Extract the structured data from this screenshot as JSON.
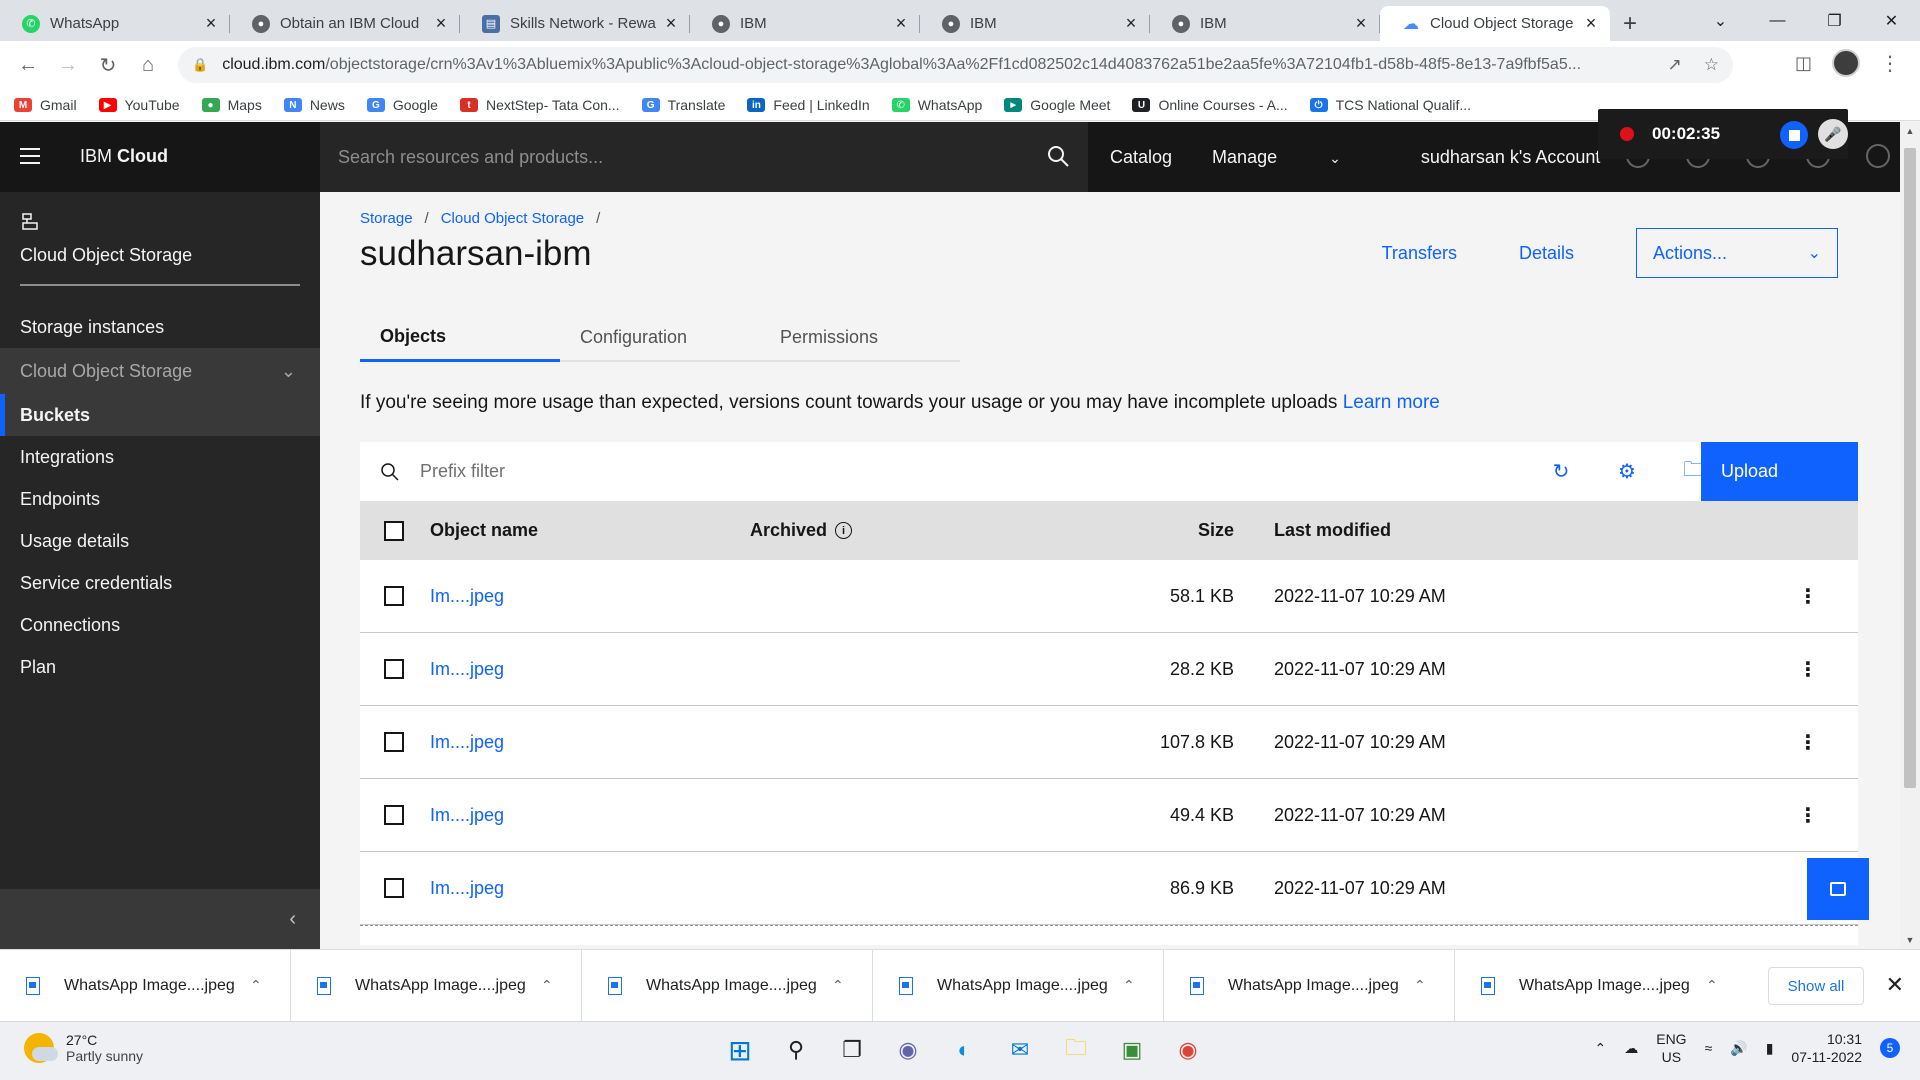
{
  "browser": {
    "tabs": [
      {
        "title": "WhatsApp",
        "fav_color": "#25d366",
        "icon": "whatsapp-icon"
      },
      {
        "title": "Obtain an IBM Cloud",
        "fav_color": "#5f6368",
        "icon": "globe-icon"
      },
      {
        "title": "Skills Network - Rewa",
        "fav_color": "#4a6fa5",
        "icon": "skills-network-icon"
      },
      {
        "title": "IBM",
        "fav_color": "#5f6368",
        "icon": "globe-icon"
      },
      {
        "title": "IBM",
        "fav_color": "#5f6368",
        "icon": "globe-icon"
      },
      {
        "title": "IBM",
        "fav_color": "#5f6368",
        "icon": "globe-icon"
      },
      {
        "title": "Cloud Object Storage",
        "fav_color": "#4589ff",
        "icon": "cloud-icon",
        "active": true
      }
    ],
    "url_host": "cloud.ibm.com",
    "url_path": "/objectstorage/crn%3Av1%3Abluemix%3Apublic%3Acloud-object-storage%3Aglobal%3Aa%2Ff1cd082502c14d4083762a51be2aa5fe%3A72104fb1-d58b-48f5-8e13-7a9fbf5a5...",
    "bookmarks": [
      {
        "label": "Gmail",
        "color": "#ea4335",
        "icon": "gmail-icon"
      },
      {
        "label": "YouTube",
        "color": "#ff0000",
        "icon": "youtube-icon"
      },
      {
        "label": "Maps",
        "color": "#34a853",
        "icon": "maps-icon"
      },
      {
        "label": "News",
        "color": "#4285f4",
        "icon": "news-icon"
      },
      {
        "label": "Google",
        "color": "#4285f4",
        "icon": "google-icon"
      },
      {
        "label": "NextStep- Tata Con...",
        "color": "#d93025",
        "icon": "tcs-icon"
      },
      {
        "label": "Translate",
        "color": "#4285f4",
        "icon": "translate-icon"
      },
      {
        "label": "Feed | LinkedIn",
        "color": "#0a66c2",
        "icon": "linkedin-icon"
      },
      {
        "label": "WhatsApp",
        "color": "#25d366",
        "icon": "whatsapp-icon"
      },
      {
        "label": "Google Meet",
        "color": "#00897b",
        "icon": "meet-icon"
      },
      {
        "label": "Online Courses - A...",
        "color": "#202124",
        "icon": "courses-icon"
      },
      {
        "label": "TCS National Qualif...",
        "color": "#1a73e8",
        "icon": "power-icon"
      }
    ]
  },
  "recorder": {
    "time": "00:02:35"
  },
  "header": {
    "brand_prefix": "IBM",
    "brand_suffix": "Cloud",
    "search_placeholder": "Search resources and products...",
    "catalog": "Catalog",
    "manage": "Manage",
    "account": "sudharsan k's Account"
  },
  "sidebar": {
    "service_title": "Cloud Object Storage",
    "items": [
      {
        "label": "Storage instances"
      }
    ],
    "section": "Cloud Object Storage",
    "selected": "Buckets",
    "sub_items": [
      "Integrations",
      "Endpoints",
      "Usage details",
      "Service credentials",
      "Connections",
      "Plan"
    ]
  },
  "main": {
    "breadcrumb": [
      "Storage",
      "Cloud Object Storage"
    ],
    "title": "sudharsan-ibm",
    "transfers": "Transfers",
    "details": "Details",
    "actions": "Actions...",
    "tabs": [
      "Objects",
      "Configuration",
      "Permissions"
    ],
    "notice_text": "If you're seeing more usage than expected, versions count towards your usage or you may have incomplete uploads",
    "notice_link": "Learn more",
    "filter_placeholder": "Prefix filter",
    "upload": "Upload",
    "columns": {
      "name": "Object name",
      "archived": "Archived",
      "size": "Size",
      "modified": "Last modified"
    },
    "rows": [
      {
        "name": "Im....jpeg",
        "size": "58.1 KB",
        "modified": "2022-11-07 10:29 AM"
      },
      {
        "name": "Im....jpeg",
        "size": "28.2 KB",
        "modified": "2022-11-07 10:29 AM"
      },
      {
        "name": "Im....jpeg",
        "size": "107.8 KB",
        "modified": "2022-11-07 10:29 AM"
      },
      {
        "name": "Im....jpeg",
        "size": "49.4 KB",
        "modified": "2022-11-07 10:29 AM"
      },
      {
        "name": "Im....jpeg",
        "size": "86.9 KB",
        "modified": "2022-11-07 10:29 AM"
      }
    ]
  },
  "downloads": {
    "items": [
      "WhatsApp Image....jpeg",
      "WhatsApp Image....jpeg",
      "WhatsApp Image....jpeg",
      "WhatsApp Image....jpeg",
      "WhatsApp Image....jpeg",
      "WhatsApp Image....jpeg"
    ],
    "show_all": "Show all"
  },
  "taskbar": {
    "temp": "27°C",
    "weather": "Partly sunny",
    "lang1": "ENG",
    "lang2": "US",
    "time": "10:31",
    "date": "07-11-2022",
    "notif_count": "5"
  },
  "colors": {
    "accent": "#0f62fe",
    "header_bg": "#161616",
    "sidebar_bg": "#262626"
  }
}
